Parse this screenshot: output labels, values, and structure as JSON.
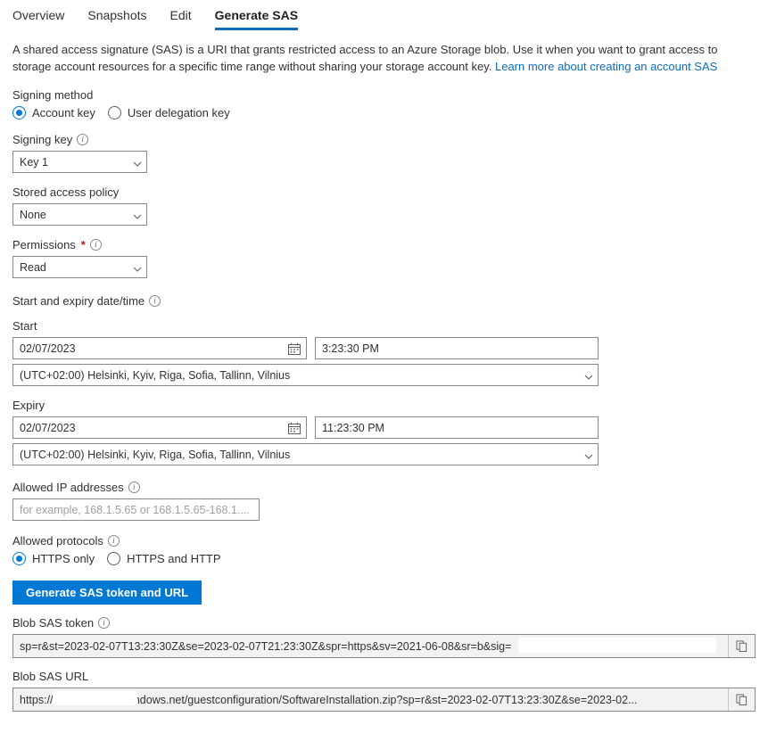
{
  "tabs": [
    {
      "label": "Overview",
      "active": false
    },
    {
      "label": "Snapshots",
      "active": false
    },
    {
      "label": "Edit",
      "active": false
    },
    {
      "label": "Generate SAS",
      "active": true
    }
  ],
  "description": {
    "text": "A shared access signature (SAS) is a URI that grants restricted access to an Azure Storage blob. Use it when you want to grant access to storage account resources for a specific time range without sharing your storage account key. ",
    "link_text": "Learn more about creating an account SAS"
  },
  "signing_method": {
    "label": "Signing method",
    "options": [
      {
        "label": "Account key",
        "selected": true
      },
      {
        "label": "User delegation key",
        "selected": false
      }
    ]
  },
  "signing_key": {
    "label": "Signing key",
    "value": "Key 1"
  },
  "stored_access_policy": {
    "label": "Stored access policy",
    "value": "None"
  },
  "permissions": {
    "label": "Permissions",
    "required_marker": "*",
    "value": "Read"
  },
  "datetime": {
    "section_label": "Start and expiry date/time",
    "start": {
      "label": "Start",
      "date": "02/07/2023",
      "time": "3:23:30 PM",
      "timezone": "(UTC+02:00) Helsinki, Kyiv, Riga, Sofia, Tallinn, Vilnius"
    },
    "expiry": {
      "label": "Expiry",
      "date": "02/07/2023",
      "time": "11:23:30 PM",
      "timezone": "(UTC+02:00) Helsinki, Kyiv, Riga, Sofia, Tallinn, Vilnius"
    }
  },
  "allowed_ip": {
    "label": "Allowed IP addresses",
    "value": "",
    "placeholder": "for example, 168.1.5.65 or 168.1.5.65-168.1...."
  },
  "allowed_protocols": {
    "label": "Allowed protocols",
    "options": [
      {
        "label": "HTTPS only",
        "selected": true
      },
      {
        "label": "HTTPS and HTTP",
        "selected": false
      }
    ]
  },
  "generate_button": {
    "label": "Generate SAS token and URL"
  },
  "sas_token": {
    "label": "Blob SAS token",
    "value": "sp=r&st=2023-02-07T13:23:30Z&se=2023-02-07T21:23:30Z&spr=https&sv=2021-06-08&sr=b&sig=                                           "
  },
  "sas_url": {
    "label": "Blob SAS URL",
    "value": "https://aza                blob.core.windows.net/guestconfiguration/SoftwareInstallation.zip?sp=r&st=2023-02-07T13:23:30Z&se=2023-02..."
  },
  "icons": {
    "info": "i",
    "calendar": "calendar-icon",
    "copy": "copy-icon",
    "chevron": "chevron-down-icon"
  },
  "colors": {
    "accent": "#0078d4",
    "tab_underline": "#0f6cbd",
    "required": "#a4262c",
    "readonly_bg": "#f3f2f1"
  }
}
